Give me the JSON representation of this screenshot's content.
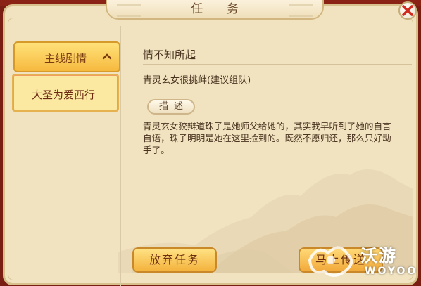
{
  "window": {
    "title": "任 务"
  },
  "sidebar": {
    "category": {
      "label": "主线剧情",
      "expanded": true
    },
    "items": [
      {
        "label": "大圣为爱西行",
        "selected": true
      }
    ]
  },
  "quest": {
    "title": "情不知所起",
    "subtitle": "青灵玄女很挑衅(建议组队)",
    "desc_tag": "描述",
    "description": "青灵玄女狡辩道珠子是她师父给她的，其实我早听到了她的自言自语，珠子明明是她在这里捡到的。既然不愿归还，那么只好动手了。"
  },
  "buttons": {
    "abandon": "放弃任务",
    "go": "马上传送"
  },
  "watermark": {
    "brand": "沃游",
    "sub": "WOYOO"
  },
  "colors": {
    "panel_bg": "#f1e3c0",
    "button_gold": "#f4b23c",
    "text_brown": "#4a3420",
    "close_red": "#d32a1e"
  },
  "icons": {
    "close": "close-x-icon",
    "chevron": "chevron-up-icon"
  }
}
